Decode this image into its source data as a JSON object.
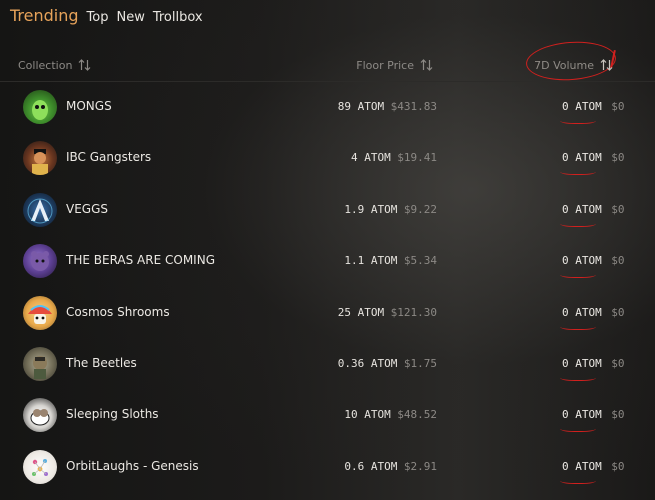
{
  "nav": {
    "tabs": [
      {
        "label": "Trending",
        "active": true
      },
      {
        "label": "Top",
        "active": false
      },
      {
        "label": "New",
        "active": false
      },
      {
        "label": "Trollbox",
        "active": false
      }
    ]
  },
  "table": {
    "headers": {
      "collection": "Collection",
      "floor_price": "Floor Price",
      "volume_7d": "7D Volume"
    },
    "rows": [
      {
        "name": "MONGS",
        "floor_atom": "89 ATOM",
        "floor_usd": "$431.83",
        "vol_atom": "0 ATOM",
        "vol_usd": "$0"
      },
      {
        "name": "IBC Gangsters",
        "floor_atom": "4 ATOM",
        "floor_usd": "$19.41",
        "vol_atom": "0 ATOM",
        "vol_usd": "$0"
      },
      {
        "name": "VEGGS",
        "floor_atom": "1.9 ATOM",
        "floor_usd": "$9.22",
        "vol_atom": "0 ATOM",
        "vol_usd": "$0"
      },
      {
        "name": "THE BERAS ARE COMING",
        "floor_atom": "1.1 ATOM",
        "floor_usd": "$5.34",
        "vol_atom": "0 ATOM",
        "vol_usd": "$0"
      },
      {
        "name": "Cosmos Shrooms",
        "floor_atom": "25 ATOM",
        "floor_usd": "$121.30",
        "vol_atom": "0 ATOM",
        "vol_usd": "$0"
      },
      {
        "name": "The Beetles",
        "floor_atom": "0.36 ATOM",
        "floor_usd": "$1.75",
        "vol_atom": "0 ATOM",
        "vol_usd": "$0"
      },
      {
        "name": "Sleeping Sloths",
        "floor_atom": "10 ATOM",
        "floor_usd": "$48.52",
        "vol_atom": "0 ATOM",
        "vol_usd": "$0"
      },
      {
        "name": "OrbitLaughs - Genesis",
        "floor_atom": "0.6 ATOM",
        "floor_usd": "$2.91",
        "vol_atom": "0 ATOM",
        "vol_usd": "$0"
      }
    ]
  },
  "colors": {
    "accent": "#e7a35a",
    "annotation": "#d0201e",
    "background": "#1b1a19"
  },
  "icons": {
    "sort": "sort-arrows-icon"
  }
}
